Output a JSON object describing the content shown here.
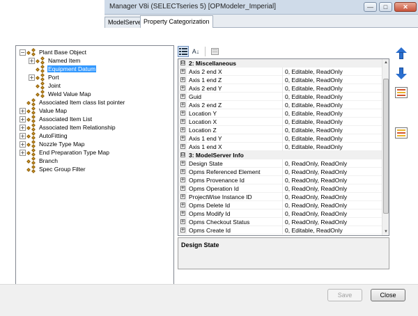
{
  "window": {
    "title": "Manager V8i (SELECTseries 5) [OPModeler_Imperial]"
  },
  "tabs": [
    {
      "label": "ModelServer"
    },
    {
      "label": "Property Categorization"
    }
  ],
  "tree": {
    "nodes": [
      {
        "label": "Plant Base Object",
        "expander": "−"
      },
      {
        "label": "Named Item",
        "expander": "+"
      },
      {
        "label": "Equipment Datum",
        "expander": "",
        "selected": true
      },
      {
        "label": "Port",
        "expander": "+"
      },
      {
        "label": "Joint",
        "expander": ""
      },
      {
        "label": "Weld Value Map",
        "expander": ""
      },
      {
        "label": "Associated Item class list pointer",
        "expander": ""
      },
      {
        "label": "Value Map",
        "expander": "+"
      },
      {
        "label": "Associated Item List",
        "expander": "+"
      },
      {
        "label": "Associated Item Relationship",
        "expander": "+"
      },
      {
        "label": "AutoFitting",
        "expander": "+"
      },
      {
        "label": "Nozzle Type Map",
        "expander": "+"
      },
      {
        "label": "End Preparation Type Map",
        "expander": "+"
      },
      {
        "label": "Branch",
        "expander": ""
      },
      {
        "label": "Spec Group Filter",
        "expander": ""
      }
    ]
  },
  "toolbar": {
    "categorized_icon": "categorized-icon",
    "alphabetical_label": "A↓",
    "pages_icon": "property-pages-icon"
  },
  "grid": {
    "categories": [
      {
        "name": "2: Miscellaneous",
        "rows": [
          {
            "name": "Axis 2 end X",
            "value": "0, Editable, ReadOnly"
          },
          {
            "name": "Axis 1 end Z",
            "value": "0, Editable, ReadOnly"
          },
          {
            "name": "Axis 2 end Y",
            "value": "0, Editable, ReadOnly"
          },
          {
            "name": "Guid",
            "value": "0, Editable, ReadOnly"
          },
          {
            "name": "Axis 2 end Z",
            "value": "0, Editable, ReadOnly"
          },
          {
            "name": "Location Y",
            "value": "0, Editable, ReadOnly"
          },
          {
            "name": "Location X",
            "value": "0, Editable, ReadOnly"
          },
          {
            "name": "Location Z",
            "value": "0, Editable, ReadOnly"
          },
          {
            "name": "Axis 1 end Y",
            "value": "0, Editable, ReadOnly"
          },
          {
            "name": "Axis 1 end X",
            "value": "0, Editable, ReadOnly"
          }
        ]
      },
      {
        "name": "3: ModelServer Info",
        "rows": [
          {
            "name": "Design State",
            "value": "0, ReadOnly, ReadOnly"
          },
          {
            "name": "Opms Referenced Element",
            "value": "0, ReadOnly, ReadOnly"
          },
          {
            "name": "Opms Provenance Id",
            "value": "0, ReadOnly, ReadOnly"
          },
          {
            "name": "Opms Operation Id",
            "value": "0, ReadOnly, ReadOnly"
          },
          {
            "name": "ProjectWise Instance ID",
            "value": "0, ReadOnly, ReadOnly"
          },
          {
            "name": "Opms Delete Id",
            "value": "0, ReadOnly, ReadOnly"
          },
          {
            "name": "Opms Modify Id",
            "value": "0, ReadOnly, ReadOnly"
          },
          {
            "name": "Opms Checkout Status",
            "value": "0, ReadOnly, ReadOnly"
          },
          {
            "name": "Opms Create Id",
            "value": "0, Editable, ReadOnly"
          }
        ]
      }
    ],
    "collapse_glyph": "⊟",
    "expand_glyph": "+"
  },
  "description": {
    "title": "Design State"
  },
  "side_buttons": [
    {
      "icon": "move-up-arrow-icon"
    },
    {
      "icon": "move-down-arrow-icon"
    },
    {
      "icon": "categorize-list-icon"
    },
    {
      "icon": "edit-category-icon"
    }
  ],
  "buttons": {
    "save": "Save",
    "close": "Close"
  },
  "window_controls": {
    "minimize": "—",
    "maximize": "□",
    "close": "✕"
  },
  "scroll": {
    "up": "▲",
    "down": "▼"
  }
}
